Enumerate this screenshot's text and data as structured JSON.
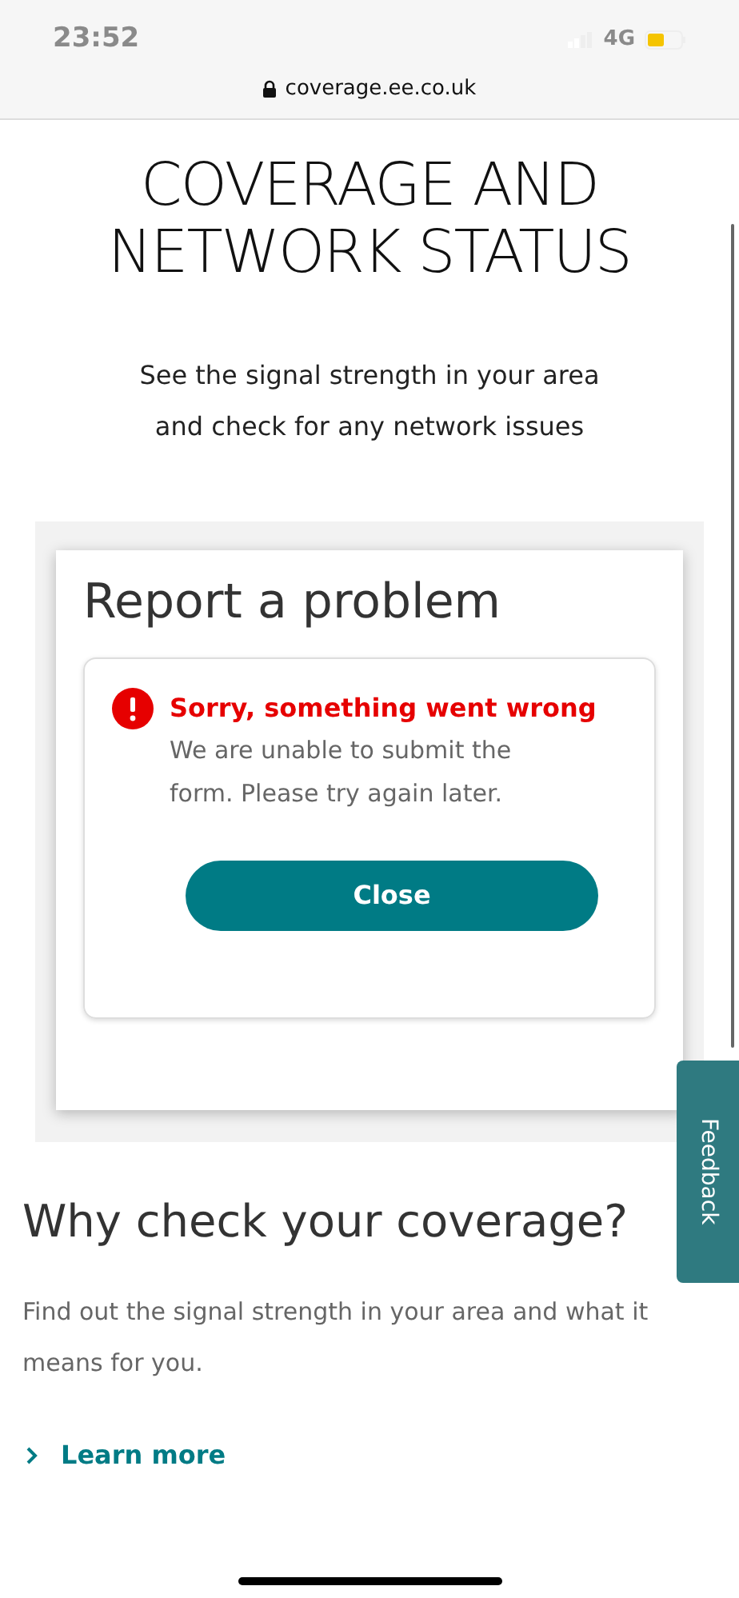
{
  "status_bar": {
    "time": "23:52",
    "network": "4G"
  },
  "address_bar": {
    "url": "coverage.ee.co.uk"
  },
  "page": {
    "title": "COVERAGE AND NETWORK STATUS",
    "subtitle_lines": [
      "See the signal strength in your area",
      "and check for any network issues"
    ]
  },
  "report_panel": {
    "title": "Report a problem",
    "error": {
      "heading": "Sorry, something went wrong",
      "message": "We are unable to submit the form. Please try again later."
    },
    "button": "Close"
  },
  "feedback_tab": {
    "label": "Feedback"
  },
  "section": {
    "heading": "Why check your coverage?",
    "body": "Find out the signal strength in your area and what it means for you.",
    "link": "Learn more"
  }
}
